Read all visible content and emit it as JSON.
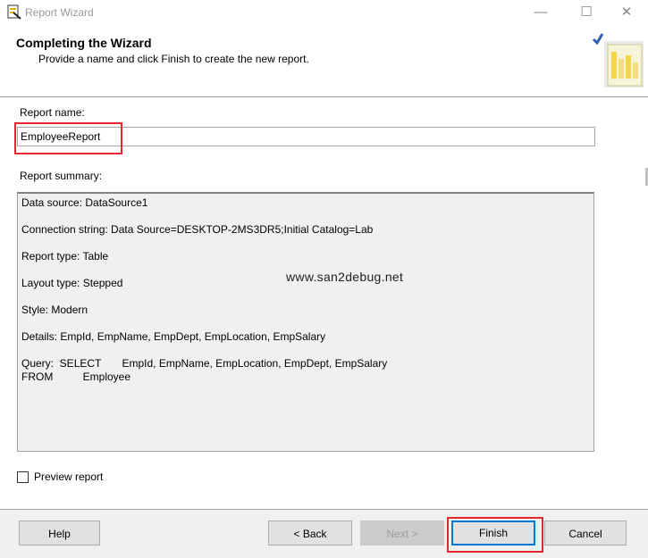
{
  "window": {
    "title": "Report Wizard"
  },
  "header": {
    "title": "Completing the Wizard",
    "subtitle": "Provide a name and click Finish to create the new report."
  },
  "form": {
    "report_name_label": "Report name:",
    "report_name_value": "EmployeeReport",
    "report_summary_label": "Report summary:",
    "summary_lines": [
      "Data source: DataSource1",
      "Connection string: Data Source=DESKTOP-2MS3DR5;Initial Catalog=Lab",
      "Report type: Table",
      "Layout type: Stepped",
      "Style: Modern",
      "Details: EmpId, EmpName, EmpDept, EmpLocation, EmpSalary"
    ],
    "query_line1": "Query:  SELECT       EmpId, EmpName, EmpLocation, EmpDept, EmpSalary",
    "query_line2": "FROM          Employee",
    "preview_label": "Preview report",
    "preview_checked": false
  },
  "watermark": "www.san2debug.net",
  "buttons": {
    "help": "Help",
    "back": "< Back",
    "next": "Next >",
    "finish": "Finish",
    "cancel": "Cancel"
  },
  "colors": {
    "highlight": "#e4262f",
    "default_button_border": "#0078d7"
  }
}
